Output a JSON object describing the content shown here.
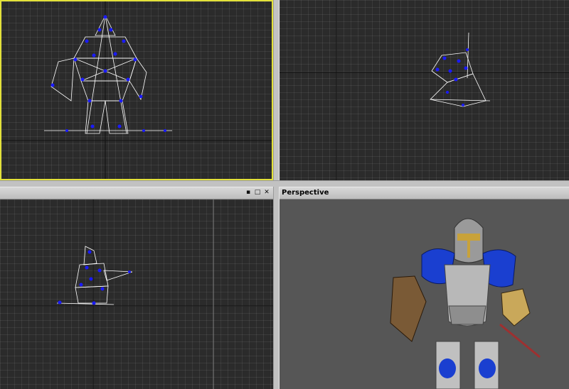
{
  "viewports": {
    "front": {
      "name": "front-viewport",
      "active": true
    },
    "top": {
      "name": "top-viewport"
    },
    "side": {
      "name": "side-viewport"
    },
    "perspective": {
      "name": "perspective-viewport",
      "title": "Perspective"
    }
  },
  "side_panel": {
    "buttons": {
      "pin": "▪",
      "restore": "□",
      "close": "✕"
    }
  },
  "colors": {
    "viewport_bg": "#2b2b2b",
    "grid_line": "#3a3a3a",
    "axis_line": "#111111",
    "active_border": "#e4e23a",
    "wire_white": "#ffffff",
    "vertex_blue": "#1a1aff",
    "perspective_bg": "#565656"
  },
  "icons": {
    "pin": "pin-icon",
    "restore": "restore-icon",
    "close": "close-icon"
  }
}
